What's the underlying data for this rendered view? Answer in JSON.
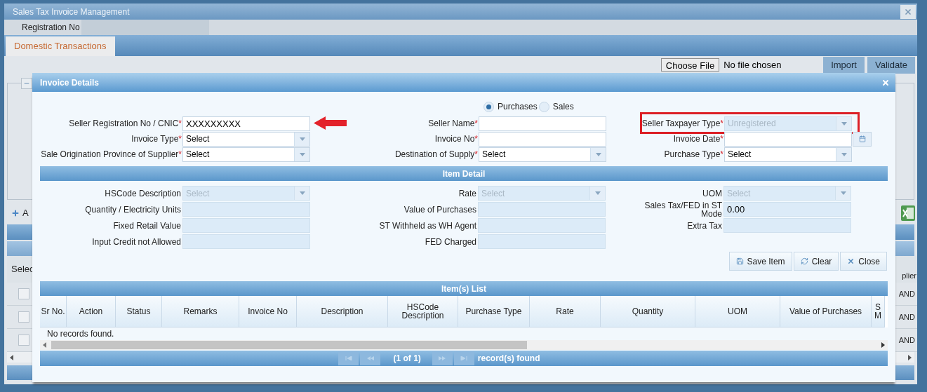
{
  "window": {
    "title": "Sales Tax Invoice Management"
  },
  "registration": {
    "label": "Registration No"
  },
  "tabs": [
    {
      "label": "Domestic Transactions",
      "selected": true
    }
  ],
  "upload": {
    "button": "Choose File",
    "status": "No file chosen"
  },
  "toolbar_buttons": [
    {
      "label": "Import"
    },
    {
      "label": "Validate"
    }
  ],
  "background": {
    "add_button": "A",
    "select_header": "Selec",
    "column_header": "plier",
    "rows": [
      {
        "cell": "AND",
        "checked": false
      },
      {
        "cell": "AND",
        "checked": false
      },
      {
        "cell": "AND",
        "checked": false
      }
    ]
  },
  "dialog": {
    "title": "Invoice Details",
    "transaction_type": [
      {
        "label": "Purchases",
        "selected": true
      },
      {
        "label": "Sales",
        "selected": false
      }
    ],
    "fields": [
      {
        "label": "Seller Registration No / CNIC",
        "mark": "*",
        "kind": "text",
        "value": "XXXXXXXXX",
        "disabled": false,
        "pointed": true,
        "highlighted": false
      },
      {
        "label": "Seller Name",
        "mark": "*",
        "kind": "text",
        "disabled": false,
        "pointed": false,
        "highlighted": false
      },
      {
        "label": "Seller Taxpayer Type",
        "mark": "*",
        "kind": "select",
        "value": "Unregistered",
        "disabled": true,
        "pointed": false,
        "highlighted": true
      },
      {
        "label": "Invoice Type",
        "mark": "*",
        "kind": "select",
        "value": "Select",
        "disabled": false,
        "pointed": false,
        "highlighted": false
      },
      {
        "label": "Invoice No",
        "mark": "*",
        "kind": "text",
        "disabled": false,
        "pointed": false,
        "highlighted": false
      },
      {
        "label": "Invoice Date",
        "mark": "*",
        "kind": "date",
        "disabled": false,
        "pointed": false,
        "highlighted": false
      },
      {
        "label": "Sale Origination Province of Supplier",
        "mark": "*",
        "kind": "select",
        "value": "Select",
        "disabled": false,
        "pointed": false,
        "highlighted": false
      },
      {
        "label": "Destination of Supply",
        "mark": "*",
        "kind": "select",
        "value": "Select",
        "disabled": false,
        "pointed": false,
        "highlighted": false
      },
      {
        "label": "Purchase Type",
        "mark": "*",
        "kind": "select",
        "value": "Select",
        "disabled": false,
        "pointed": false,
        "highlighted": false
      }
    ],
    "item_detail": {
      "title": "Item Detail",
      "fields": [
        {
          "label": "HSCode Description",
          "kind": "select",
          "value": "Select",
          "disabled": true
        },
        {
          "label": "Rate",
          "kind": "select",
          "value": "Select",
          "disabled": true
        },
        {
          "label": "UOM",
          "kind": "select",
          "value": "Select",
          "disabled": true
        },
        {
          "label": "Quantity / Electricity Units",
          "kind": "text",
          "disabled": true
        },
        {
          "label": "Value of Purchases",
          "kind": "text",
          "disabled": true
        },
        {
          "label": "Sales Tax/FED in ST Mode",
          "kind": "text",
          "value": "0.00",
          "disabled": true
        },
        {
          "label": "Fixed Retail Value",
          "kind": "text",
          "disabled": true
        },
        {
          "label": "ST Withheld as WH Agent",
          "kind": "text",
          "disabled": true
        },
        {
          "label": "Extra Tax",
          "kind": "text",
          "disabled": true
        },
        {
          "label": "Input Credit not Allowed",
          "kind": "text",
          "disabled": true
        },
        {
          "label": "FED Charged",
          "kind": "text",
          "disabled": true
        }
      ]
    },
    "actions": [
      {
        "label": "Save Item",
        "kind": "save"
      },
      {
        "label": "Clear",
        "kind": "clear"
      },
      {
        "label": "Close",
        "kind": "close"
      }
    ],
    "items_list": {
      "title": "Item(s) List",
      "columns": [
        "Sr No.",
        "Action",
        "Status",
        "Remarks",
        "Invoice No",
        "Description",
        "HSCode Description",
        "Purchase Type",
        "Rate",
        "Quantity",
        "UOM",
        "Value of Purchases",
        "S M"
      ],
      "empty_message": "No records found.",
      "pager": {
        "page": "(1 of 1)",
        "summary": "record(s) found"
      }
    }
  }
}
